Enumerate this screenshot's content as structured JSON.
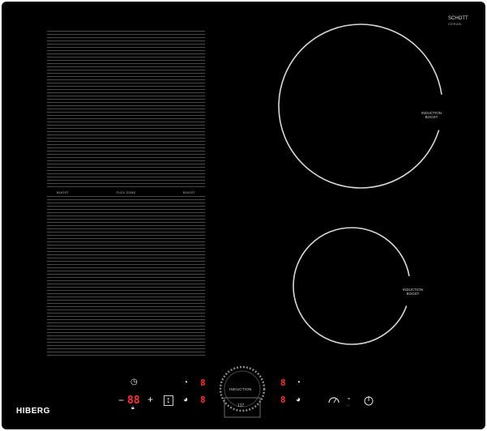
{
  "brand": {
    "name": "HIBERG",
    "glass_maker": "SCHOTT",
    "glass_type": "CERAN"
  },
  "flex_zone": {
    "left_label": "BOOST",
    "center_label": "FLEX ZONE",
    "right_label": "BOOST"
  },
  "zones": {
    "top_right": {
      "label_line1": "INDUCTION",
      "label_line2": "BOOST"
    },
    "bottom_right": {
      "label_line1": "INDUCTION",
      "label_line2": "BOOST"
    }
  },
  "controls": {
    "timer_display": "88",
    "timer_minus": "−",
    "timer_plus": "+",
    "center_label": "INDUCTION",
    "center_value": "137",
    "zone_digits": [
      "8",
      "8",
      "8",
      "8"
    ],
    "power_icon": "power-icon",
    "clock_icon": "clock-icon",
    "lock_icon": "lock-icon"
  },
  "colors": {
    "glass": "#000000",
    "display": "#ff3030",
    "lines": "#4a4a4a"
  }
}
